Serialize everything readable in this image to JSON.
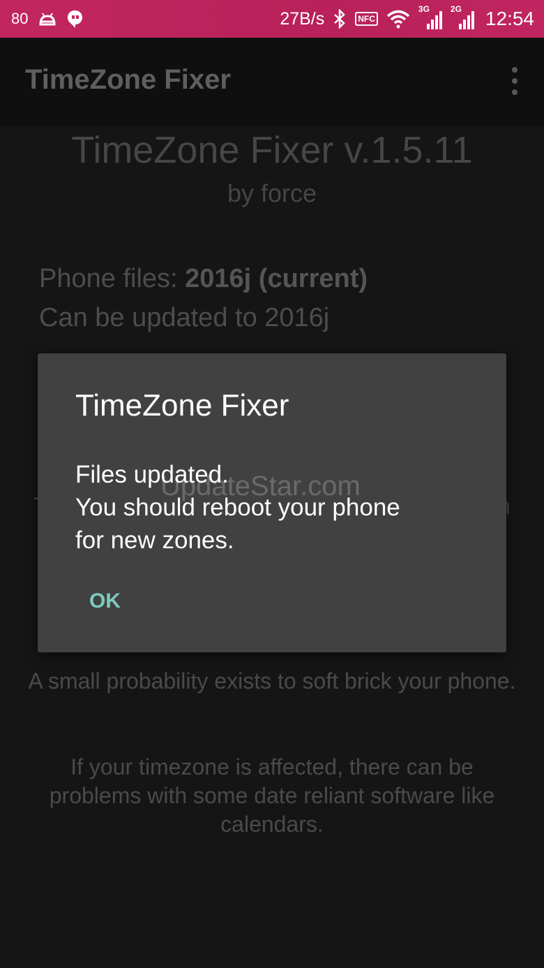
{
  "status_bar": {
    "battery_text": "80",
    "net_speed": "27B/s",
    "nfc_label": "NFC",
    "sim1_tag": "3G",
    "sim2_tag": "2G",
    "time": "12:54",
    "icons": [
      "android-icon",
      "hangouts-icon",
      "bluetooth-icon",
      "nfc-icon",
      "wifi-icon",
      "signal-icon"
    ]
  },
  "app_bar": {
    "title": "TimeZone Fixer",
    "menu_icon": "overflow-menu-icon"
  },
  "main": {
    "heading": "TimeZone Fixer v.1.5.11",
    "author": "by force",
    "phone_files_label": "Phone files: ",
    "phone_files_value": "2016j (current)",
    "update_status": "Can be updated to 2016j",
    "partial_left": "T",
    "partial_right": "n",
    "warning": "A small probability exists to soft brick your phone.",
    "note": "If your timezone is affected, there can be problems with some date reliant software like calendars."
  },
  "dialog": {
    "title": "TimeZone Fixer",
    "message_lines": [
      "Files updated.",
      "You should reboot your phone",
      "for new zones."
    ],
    "ok_label": "OK",
    "accent_color": "#7ecbbd"
  },
  "watermark": "UpdateStar.com",
  "colors": {
    "status_bar": "#c2265e",
    "background": "#151515",
    "dialog": "#414141"
  }
}
